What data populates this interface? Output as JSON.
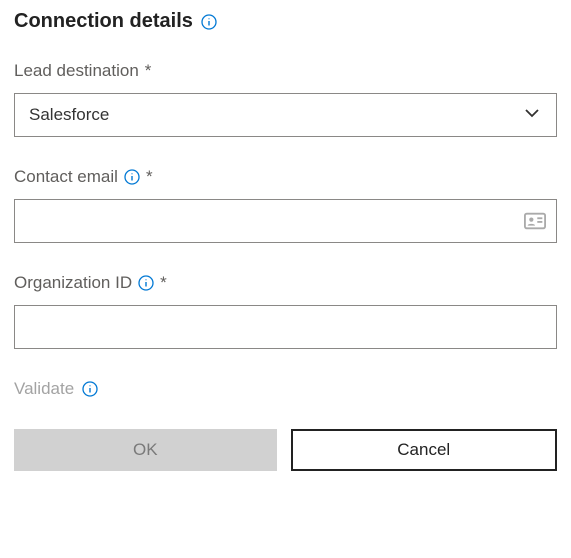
{
  "header": {
    "title": "Connection details"
  },
  "fields": {
    "leadDestination": {
      "label": "Lead destination",
      "required": "*",
      "value": "Salesforce"
    },
    "contactEmail": {
      "label": "Contact email",
      "required": "*",
      "value": ""
    },
    "organizationId": {
      "label": "Organization ID",
      "required": "*",
      "value": ""
    }
  },
  "validate": {
    "label": "Validate"
  },
  "buttons": {
    "ok": "OK",
    "cancel": "Cancel"
  }
}
